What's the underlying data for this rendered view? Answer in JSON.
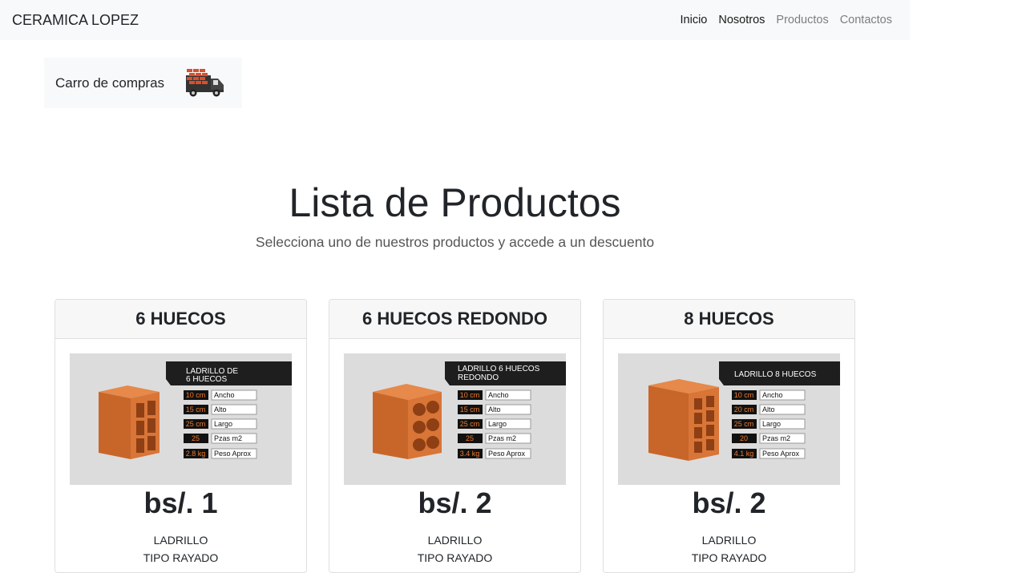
{
  "navbar": {
    "brand": "CERAMICA LOPEZ",
    "links": [
      "Inicio",
      "Nosotros",
      "Productos",
      "Contactos"
    ]
  },
  "cart": {
    "label": "Carro de compras",
    "icon": "delivery-truck-icon"
  },
  "main": {
    "title": "Lista de Productos",
    "subtitle": "Selecciona uno de nuestros productos y accede a un descuento"
  },
  "products": [
    {
      "name": "6 HUECOS",
      "image": {
        "heading": [
          "LADRILLO DE",
          "6 HUECOS"
        ],
        "specs": [
          {
            "value": "10 cm",
            "label": "Ancho"
          },
          {
            "value": "15 cm",
            "label": "Alto"
          },
          {
            "value": "25 cm",
            "label": "Largo"
          },
          {
            "value": "25",
            "label": "Pzas m2"
          },
          {
            "value": "2.8 kg",
            "label": "Peso Aprox"
          }
        ]
      },
      "price": "bs/. 1",
      "line1": "LADRILLO",
      "line2": "TIPO RAYADO"
    },
    {
      "name": "6 HUECOS REDONDO",
      "image": {
        "heading": [
          "LADRILLO 6 HUECOS",
          "REDONDO"
        ],
        "specs": [
          {
            "value": "10 cm",
            "label": "Ancho"
          },
          {
            "value": "15 cm",
            "label": "Alto"
          },
          {
            "value": "25 cm",
            "label": "Largo"
          },
          {
            "value": "25",
            "label": "Pzas m2"
          },
          {
            "value": "3.4 kg",
            "label": "Peso Aprox"
          }
        ]
      },
      "price": "bs/. 2",
      "line1": "LADRILLO",
      "line2": "TIPO RAYADO"
    },
    {
      "name": "8 HUECOS",
      "image": {
        "heading": [
          "LADRILLO 8 HUECOS"
        ],
        "specs": [
          {
            "value": "10 cm",
            "label": "Ancho"
          },
          {
            "value": "20 cm",
            "label": "Alto"
          },
          {
            "value": "25 cm",
            "label": "Largo"
          },
          {
            "value": "20",
            "label": "Pzas m2"
          },
          {
            "value": "4.1 kg",
            "label": "Peso Aprox"
          }
        ]
      },
      "price": "bs/. 2",
      "line1": "LADRILLO",
      "line2": "TIPO RAYADO"
    }
  ]
}
